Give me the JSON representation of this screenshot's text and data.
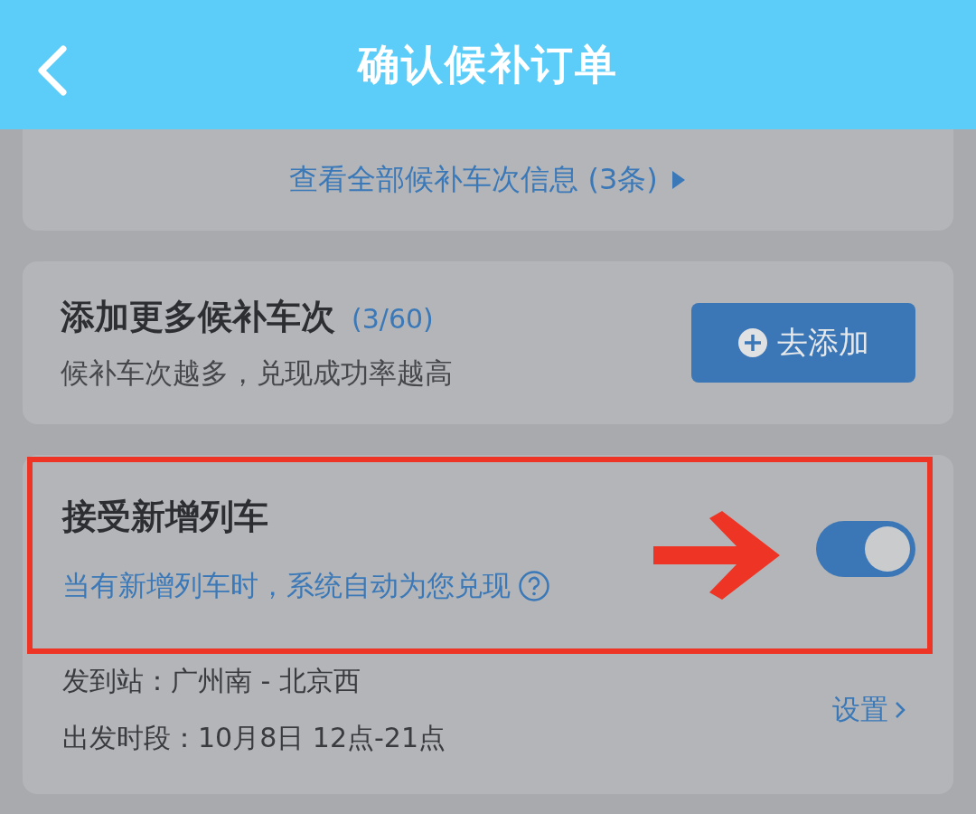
{
  "header": {
    "title": "确认候补订单"
  },
  "all_trains_link": {
    "label": "查看全部候补车次信息 (3条)"
  },
  "add_trains": {
    "title": "添加更多候补车次",
    "count": "(3/60)",
    "hint": "候补车次越多，兑现成功率越高",
    "button": "去添加"
  },
  "new_trains": {
    "title": "接受新增列车",
    "description": "当有新增列车时，系统自动为您兑现",
    "on": true,
    "highlighted": true,
    "details": [
      "发到站：广州南 - 北京西",
      "出发时段：10月8日 12点-21点"
    ],
    "settings_link": "设置"
  }
}
